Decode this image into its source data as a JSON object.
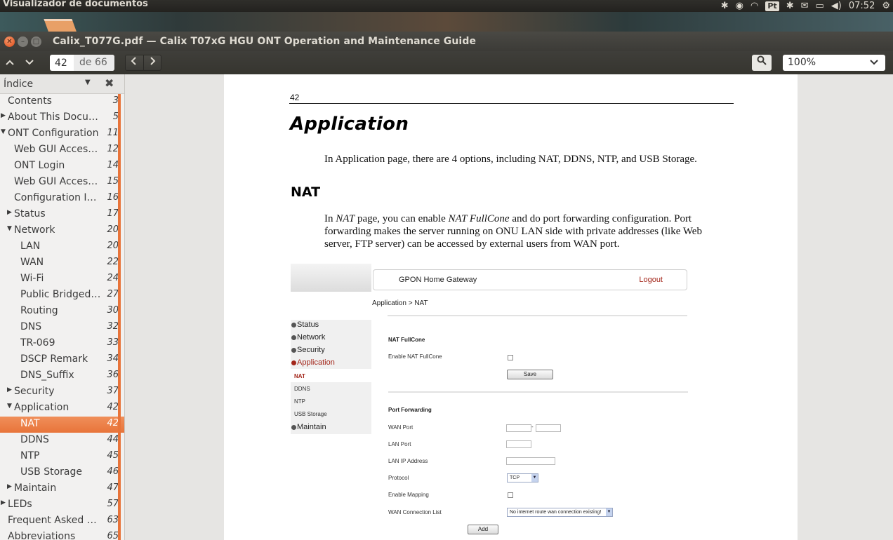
{
  "top_panel": {
    "app_name": "Visualizador de documentos",
    "keyboard_layout": "Pt",
    "clock": "07:52",
    "tray_icons": [
      "bluetooth-icon",
      "network-sync-icon",
      "wifi-icon",
      "keyboard-icon",
      "bluetooth-icon",
      "mail-icon",
      "battery-icon",
      "volume-icon",
      "gear-icon"
    ]
  },
  "window": {
    "title": "Calix_T077G.pdf — Calix T07xG HGU ONT Operation and Maintenance Guide"
  },
  "toolbar": {
    "prev_page_icon": "chevron-up",
    "next_page_icon": "chevron-down",
    "page_current": "42",
    "page_of": "de 66",
    "back_icon": "chevron-left",
    "forward_icon": "chevron-right",
    "zoom": "100%"
  },
  "sidebar": {
    "header_label": "Índice",
    "items": [
      {
        "label": "Contents",
        "page": "3",
        "level": 0,
        "toggle": "none"
      },
      {
        "label": "About This Docu…",
        "page": "5",
        "level": 0,
        "toggle": "collapsed"
      },
      {
        "label": "ONT Configuration",
        "page": "11",
        "level": 0,
        "toggle": "expanded"
      },
      {
        "label": "Web GUI Access…",
        "page": "12",
        "level": 1,
        "toggle": "none"
      },
      {
        "label": "ONT Login",
        "page": "14",
        "level": 1,
        "toggle": "none"
      },
      {
        "label": "Web GUI Access…",
        "page": "15",
        "level": 1,
        "toggle": "none"
      },
      {
        "label": "Configuration In…",
        "page": "16",
        "level": 1,
        "toggle": "none"
      },
      {
        "label": "Status",
        "page": "17",
        "level": 1,
        "toggle": "collapsed"
      },
      {
        "label": "Network",
        "page": "20",
        "level": 1,
        "toggle": "expanded"
      },
      {
        "label": "LAN",
        "page": "20",
        "level": 2,
        "toggle": "none"
      },
      {
        "label": "WAN",
        "page": "22",
        "level": 2,
        "toggle": "none"
      },
      {
        "label": "Wi-Fi",
        "page": "24",
        "level": 2,
        "toggle": "none"
      },
      {
        "label": "Public Bridged …",
        "page": "27",
        "level": 2,
        "toggle": "none"
      },
      {
        "label": "Routing",
        "page": "30",
        "level": 2,
        "toggle": "none"
      },
      {
        "label": "DNS",
        "page": "32",
        "level": 2,
        "toggle": "none"
      },
      {
        "label": "TR-069",
        "page": "33",
        "level": 2,
        "toggle": "none"
      },
      {
        "label": "DSCP Remark",
        "page": "34",
        "level": 2,
        "toggle": "none"
      },
      {
        "label": "DNS_Suffix",
        "page": "36",
        "level": 2,
        "toggle": "none"
      },
      {
        "label": "Security",
        "page": "37",
        "level": 1,
        "toggle": "collapsed"
      },
      {
        "label": "Application",
        "page": "42",
        "level": 1,
        "toggle": "expanded"
      },
      {
        "label": "NAT",
        "page": "42",
        "level": 2,
        "toggle": "none",
        "selected": true
      },
      {
        "label": "DDNS",
        "page": "44",
        "level": 2,
        "toggle": "none"
      },
      {
        "label": "NTP",
        "page": "45",
        "level": 2,
        "toggle": "none"
      },
      {
        "label": "USB Storage",
        "page": "46",
        "level": 2,
        "toggle": "none"
      },
      {
        "label": "Maintain",
        "page": "47",
        "level": 1,
        "toggle": "collapsed"
      },
      {
        "label": "LEDs",
        "page": "57",
        "level": 0,
        "toggle": "collapsed"
      },
      {
        "label": "Frequent Asked …",
        "page": "63",
        "level": 0,
        "toggle": "none"
      },
      {
        "label": "Abbreviations",
        "page": "65",
        "level": 0,
        "toggle": "none"
      }
    ]
  },
  "document": {
    "page_number": "42",
    "heading": "Application",
    "intro": "In Application page, there are 4 options, including NAT, DDNS, NTP, and USB Storage.",
    "subheading": "NAT",
    "nat_para_1": "In ",
    "nat_para_em1": "NAT",
    "nat_para_2": " page, you can enable ",
    "nat_para_em2": "NAT FullCone",
    "nat_para_3": " and do port forwarding configuration. Port forwarding makes the server running on ONU LAN side with private addresses (like Web server, FTP server) can be accessed by external users from WAN port."
  },
  "router_ui": {
    "header_title": "GPON Home Gateway",
    "logout": "Logout",
    "breadcrumb": "Application > NAT",
    "menu": [
      "Status",
      "Network",
      "Security",
      "Application"
    ],
    "submenu": [
      "NAT",
      "DDNS",
      "NTP",
      "USB Storage"
    ],
    "menu_last": "Maintain",
    "nat_fullcone_title": "NAT FullCone",
    "enable_nat_fullcone": "Enable NAT FullCone",
    "save": "Save",
    "port_forwarding_title": "Port Forwarding",
    "wan_port": "WAN Port",
    "lan_port": "LAN Port",
    "lan_ip": "LAN IP Address",
    "protocol": "Protocol",
    "protocol_value": "TCP",
    "enable_mapping": "Enable Mapping",
    "wan_conn_list": "WAN Connection List",
    "wan_conn_value": "No internet route wan connection existing!",
    "add": "Add",
    "range_dash": "-"
  }
}
